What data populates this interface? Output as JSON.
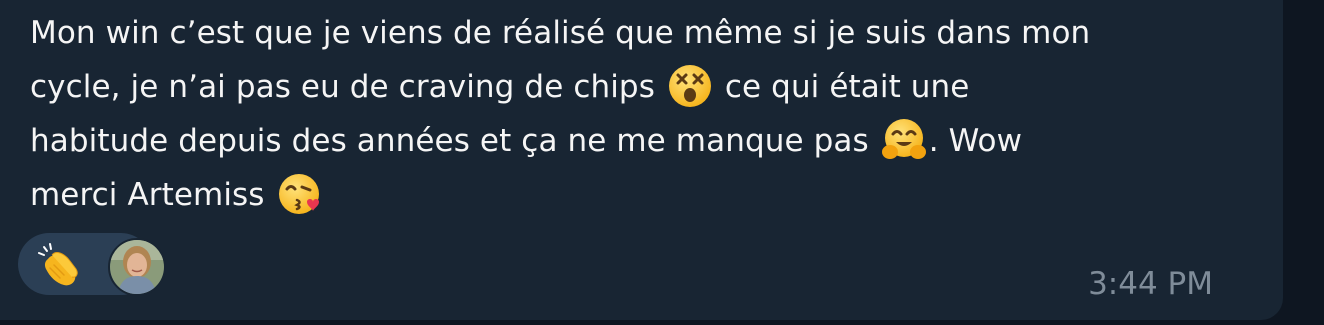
{
  "message": {
    "line1": "Mon win c’est que je viens de réalisé que même si je suis dans mon",
    "line2_before_emoji": "cycle, je n’ai pas eu de craving de chips",
    "line2_after_emoji": "ce qui était une",
    "line3_before_emoji": "habitude depuis des années et ça ne me manque pas",
    "line3_after_emoji": ". Wow",
    "line4_before_emoji": "merci Artemiss",
    "emojis": [
      "dizzy-face-emoji",
      "hugging-face-emoji",
      "face-blowing-kiss-emoji"
    ]
  },
  "reaction": {
    "emoji": "clapping-hands-emoji",
    "reactor": "avatar"
  },
  "time": "3:44 PM",
  "colors": {
    "background": "#0e1621",
    "bubble": "#182533",
    "text": "#f5f5f5",
    "time": "#7f8c99",
    "reaction_pill": "#2b3f55"
  }
}
